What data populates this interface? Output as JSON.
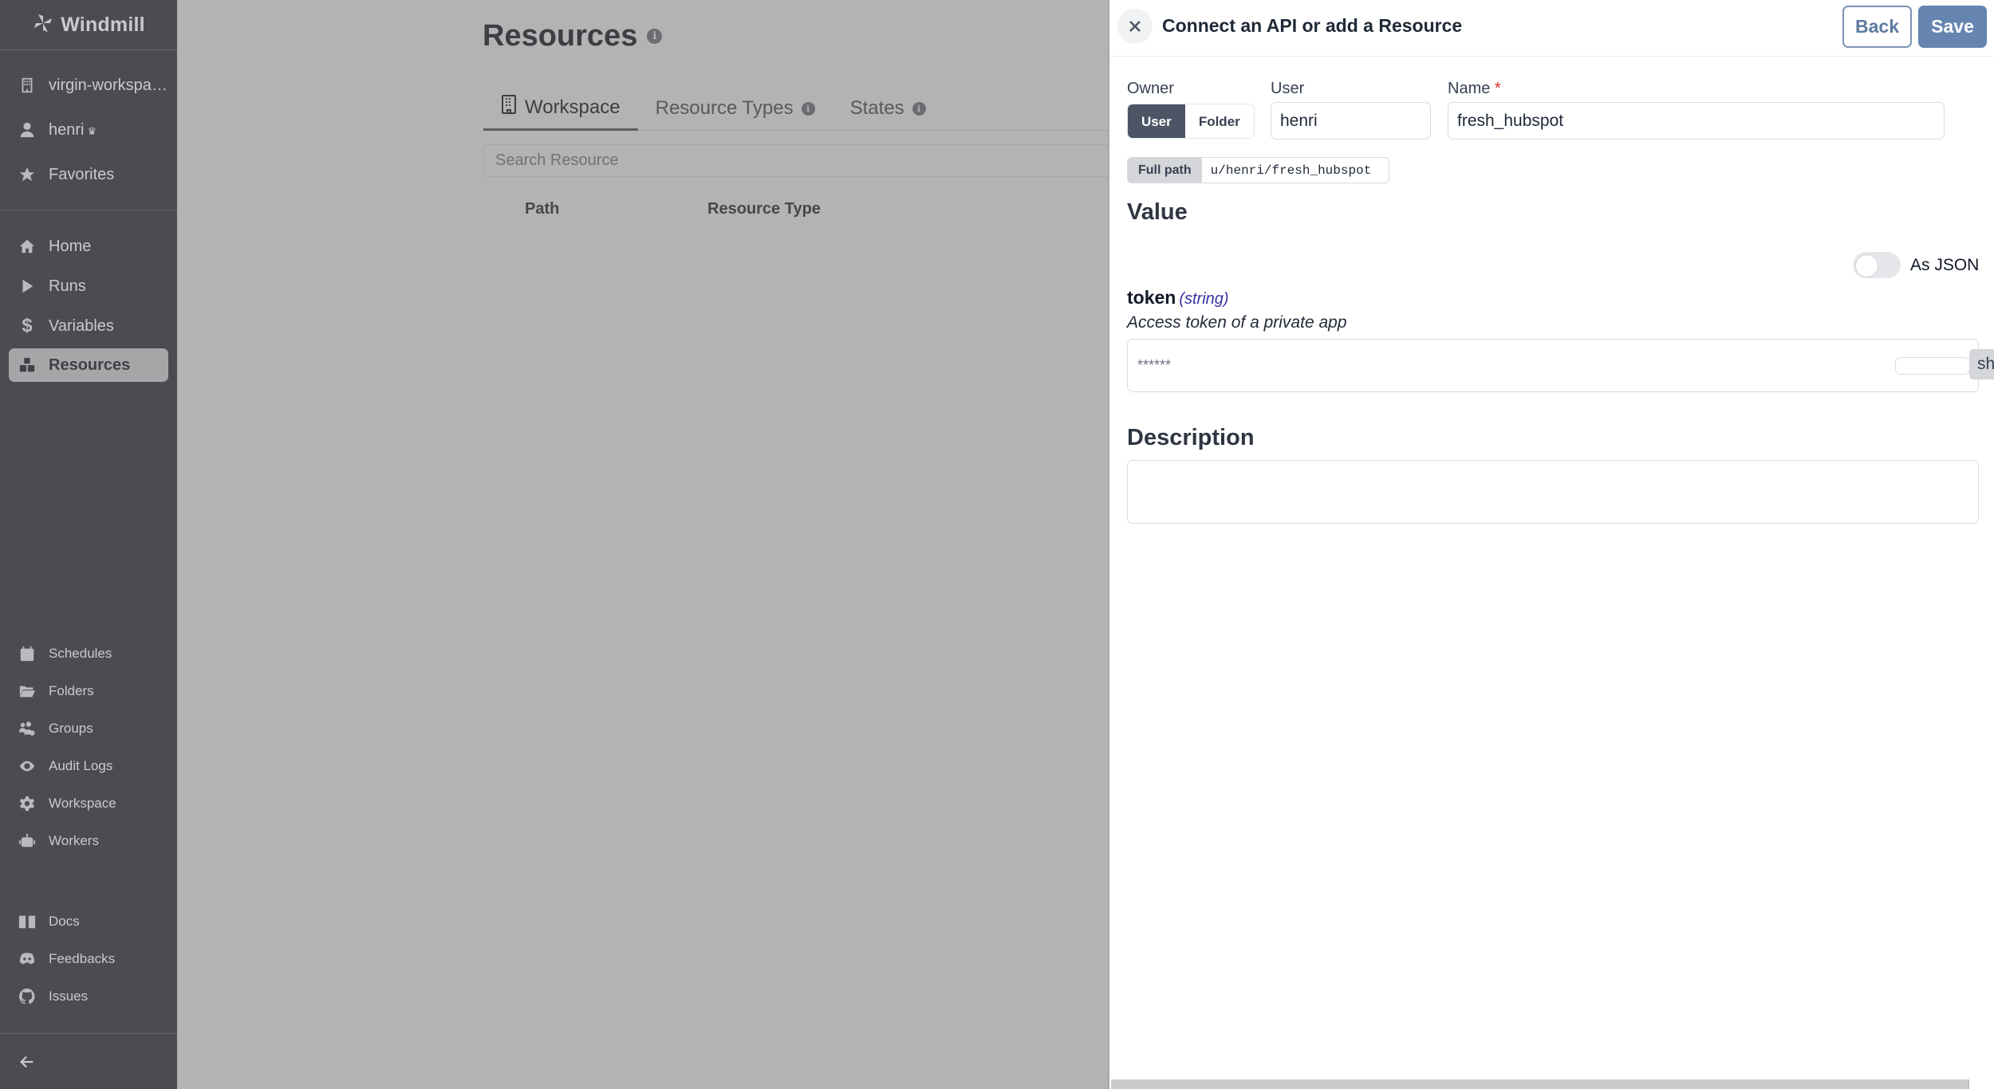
{
  "sidebar": {
    "brand": "Windmill",
    "workspace": "virgin-workspace",
    "user": "henri",
    "user_badge": "♛",
    "top_items": [
      {
        "label": "Favorites",
        "icon": "star-icon"
      }
    ],
    "main_items": [
      {
        "label": "Home",
        "icon": "home-icon"
      },
      {
        "label": "Runs",
        "icon": "play-icon"
      },
      {
        "label": "Variables",
        "icon": "dollar-icon"
      },
      {
        "label": "Resources",
        "icon": "cubes-icon",
        "active": true
      }
    ],
    "admin_items": [
      {
        "label": "Schedules",
        "icon": "calendar-icon"
      },
      {
        "label": "Folders",
        "icon": "folder-open-icon"
      },
      {
        "label": "Groups",
        "icon": "users-cog-icon"
      },
      {
        "label": "Audit Logs",
        "icon": "eye-icon"
      },
      {
        "label": "Workspace",
        "icon": "gear-icon"
      },
      {
        "label": "Workers",
        "icon": "robot-icon"
      }
    ],
    "help_items": [
      {
        "label": "Docs",
        "icon": "book-icon"
      },
      {
        "label": "Feedbacks",
        "icon": "discord-icon"
      },
      {
        "label": "Issues",
        "icon": "github-icon"
      }
    ],
    "collapse_icon": "arrow-left-icon"
  },
  "page": {
    "title": "Resources",
    "tabs": [
      {
        "label": "Workspace",
        "active": true,
        "icon": "building-icon"
      },
      {
        "label": "Resource Types",
        "info": true
      },
      {
        "label": "States",
        "info": true
      }
    ],
    "search_placeholder": "Search Resource",
    "columns": [
      "Path",
      "Resource Type"
    ]
  },
  "drawer": {
    "title": "Connect an API or add a Resource",
    "back_label": "Back",
    "save_label": "Save",
    "owner_label": "Owner",
    "owner_options": [
      "User",
      "Folder"
    ],
    "owner_selected": "User",
    "user_label": "User",
    "user_value": "henri",
    "name_label": "Name",
    "name_required_mark": "*",
    "name_value": "fresh_hubspot",
    "full_path_label": "Full path",
    "full_path_value": "u/henri/fresh_hubspot",
    "value_heading": "Value",
    "as_json_label": "As JSON",
    "as_json_on": false,
    "field": {
      "name": "token",
      "type": "(string)",
      "description": "Access token of a private app",
      "masked_value": "******",
      "show_label": "show"
    },
    "description_heading": "Description",
    "description_value": ""
  },
  "colors": {
    "sidebar_bg": "#4b4c51",
    "overlay": "#b3b3b3",
    "primary": "#6585b0",
    "segment_active": "#4b5565",
    "required": "#dc2626",
    "type_hint": "#3730a3"
  }
}
